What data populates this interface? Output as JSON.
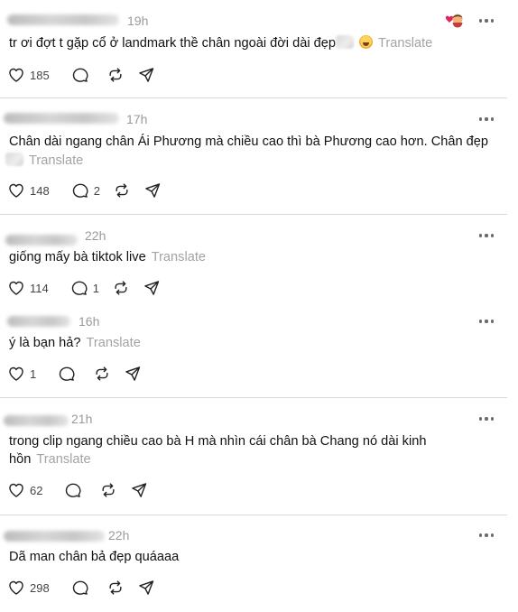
{
  "translate_label": "Translate",
  "icons": {
    "like": "heart-icon",
    "reply": "comment-icon",
    "repost": "repost-icon",
    "share": "send-icon",
    "more": "more-dots-icon"
  },
  "posts": [
    {
      "time": "19h",
      "text": "tr ơi đợt t gặp cổ ở landmark thề chân ngoài đời dài đẹp",
      "likes": "185",
      "replies": "",
      "has_face_emoji": true,
      "has_reaction_badge": true
    },
    {
      "time": "17h",
      "text": "Chân dài ngang chân Ái Phương mà chiều cao thì bà Phương cao hơn. Chân đẹp",
      "likes": "148",
      "replies": "2"
    },
    {
      "time": "22h",
      "text": "giống mấy bà tiktok live",
      "likes": "114",
      "replies": "1"
    },
    {
      "time": "16h",
      "text": "ý là bạn hả?",
      "likes": "1",
      "replies": ""
    },
    {
      "time": "21h",
      "text_line1": "trong clip ngang chiều cao bà H mà nhìn cái chân bà Chang nó dài kinh",
      "text_line2": "hồn",
      "likes": "62",
      "replies": ""
    },
    {
      "time": "22h",
      "text": "Dã man chân bả đẹp quáaaa",
      "likes": "298",
      "replies": ""
    }
  ]
}
